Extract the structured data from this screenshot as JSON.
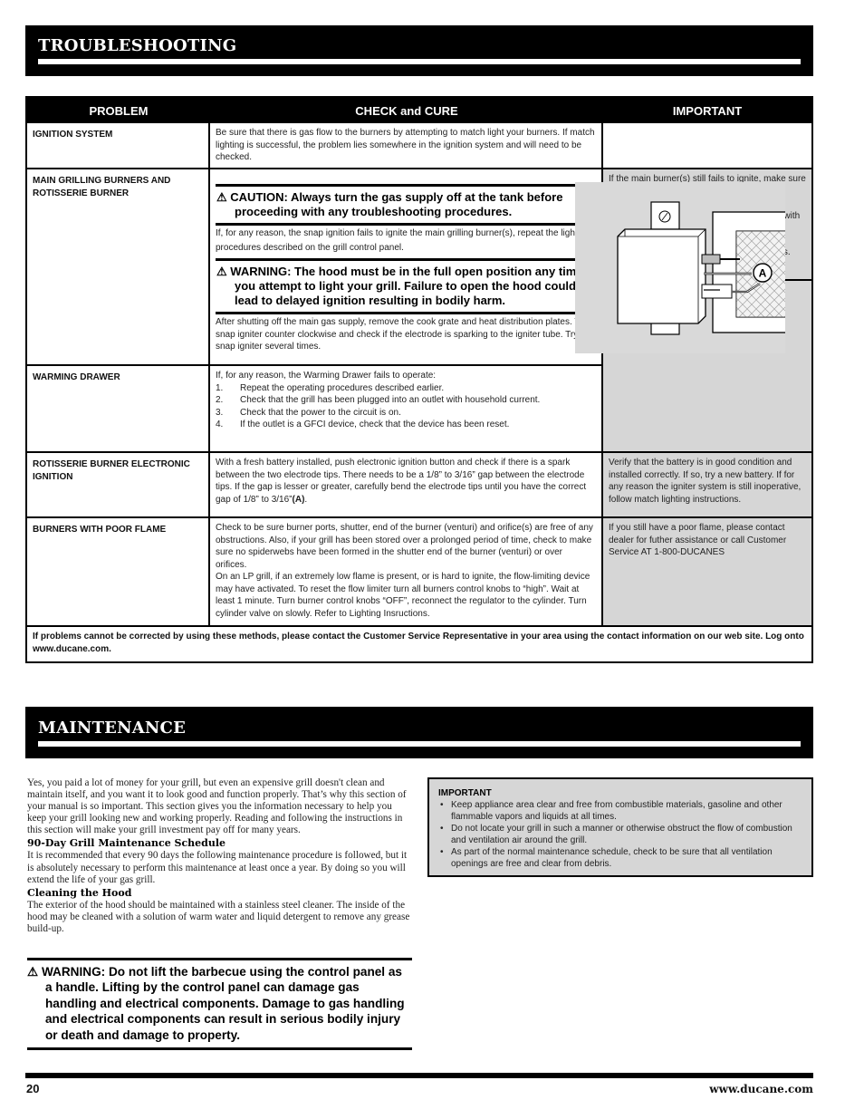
{
  "troubleshooting": {
    "title": "TROUBLESHOOTING",
    "columns": [
      "PROBLEM",
      "CHECK and CURE",
      "IMPORTANT"
    ],
    "rows": [
      {
        "problem": "IGNITION SYSTEM",
        "cure": "Be sure that there is gas flow to the burners by attempting to match light your burners. If match lighting is successful, the problem lies somewhere in the ignition system and will need to be checked.",
        "important": ""
      },
      {
        "problem": "MAIN GRILLING BURNERS AND ROTISSERIE BURNER",
        "caution": "CAUTION: Always turn the gas supply off at the tank before proceeding with any troubleshooting procedures.",
        "cure_1": "If, for any reason, the snap ignition fails to ignite the main grilling burner(s), repeat the lighting procedures described on the grill control panel.",
        "warning": "WARNING: The hood must be in the full open position any time you attempt to light your grill. Failure to  open the hood could lead to delayed ignition resulting in bodily harm.",
        "cure_2": "After shutting off the main gas supply, remove the cook grate and heat distribution plates. Turn snap igniter counter clockwise and check if the electrode is sparking to the igniter tube. Try the snap igniter several times.",
        "important": "If the main burner(s) still fails to ignite, make sure that there is gas flowing to the burner(s) by attempting to match light the burner(s).\nIf the burners will match light, then proceed with the ignition checkout.\nIf for any reason the igniter system is still inoperative, follow match lighting instructions."
      },
      {
        "problem": "WARMING DRAWER",
        "cure_intro": "If, for any reason, the Warming Drawer fails to operate:",
        "cure_steps": [
          {
            "n": "1.",
            "text": "Repeat the operating procedures described earlier."
          },
          {
            "n": "2.",
            "text": "Check that the grill has been plugged into an outlet with household current."
          },
          {
            "n": "3.",
            "text": "Check that the power to the circuit is on."
          },
          {
            "n": "4.",
            "text": "If the outlet is a GFCI device, check that the device has been reset."
          }
        ]
      },
      {
        "problem": "ROTISSERIE BURNER ELECTRONIC IGNITION",
        "cure": "With a fresh battery installed, push electronic ignition button and check if there is a spark between the two electrode tips. There needs to be a 1/8” to 3/16” gap between the electrode tips. If the gap is lesser or greater, carefully bend the electrode tips until you have the correct gap of 1/8” to 3/16”",
        "cure_ref": "(A)",
        "cure_end": ".",
        "important": "Verify that the battery is in good condition and installed correctly. If so, try a new battery. If for any reason the igniter system is still inoperative, follow match lighting instructions."
      },
      {
        "problem": "BURNERS WITH POOR FLAME",
        "cure_1": "Check to be sure burner ports, shutter, end of the burner (venturi) and orifice(s) are free of any obstructions. Also, if your grill has been stored over a prolonged period of time, check to make sure no spiderwebs have been formed in the shutter end of the burner (venturi) or over orifices.",
        "cure_2": "On an LP grill, if an extremely low flame is present, or is hard to ignite, the flow-limiting device may have activated. To reset the flow limiter turn all burners control knobs to “high”. Wait at least 1 minute. Turn burner control knobs “OFF”, reconnect the regulator to the cylinder. Turn cylinder valve on slowly. Refer to Lighting Insructions.",
        "important": "If you still have a poor flame, please contact dealer for futher assistance or call Customer Service AT 1-800-DUCANES"
      }
    ],
    "figure_label": "A",
    "footer": "If problems cannot be corrected by using these methods, please contact the Customer Service Representative in your area using the contact information on our web site. Log onto www.ducane.com."
  },
  "maintenance": {
    "title": "MAINTENANCE",
    "intro": "Yes, you paid a lot of money for your grill, but even an expensive grill doesn't clean and maintain itself, and you want it to look good and function properly. That’s why this section of your manual is so important. This section gives you the information necessary to help you keep your grill looking new and working properly. Reading and following the instructions in this section will make your grill investment pay off for many years.",
    "schedule_heading": "90-Day Grill Maintenance Schedule",
    "schedule_text": "It is recommended that every 90 days the following maintenance procedure is followed, but it is absolutely necessary to perform this maintenance at least once a year. By doing so you will extend the life of your gas grill.",
    "hood_heading": "Cleaning the Hood",
    "hood_text": "The exterior of the hood should be maintained with a stainless steel cleaner. The inside of the hood may be cleaned with a solution of warm water and liquid detergent to remove any grease build-up.",
    "important_heading": "IMPORTANT",
    "important_items": [
      "Keep appliance area clear and free from combustible materials, gasoline and other flammable vapors and liquids at all times.",
      "Do not locate your grill in such a manner or otherwise obstruct the flow of combustion and ventilation air around the grill.",
      "As part of the normal maintenance schedule, check to be sure that all ventilation openings are free and clear from debris."
    ],
    "warning": "WARNING: Do not lift the barbecue using the control panel as a handle. Lifting by the control panel can damage gas handling and electrical components. Damage to gas handling and electrical components can result in serious bodily injury or death and damage to property."
  },
  "icons": {
    "warning_glyph": "⚠",
    "bullet": "•"
  },
  "footer": {
    "page_number": "20",
    "website": "www.ducane.com"
  }
}
